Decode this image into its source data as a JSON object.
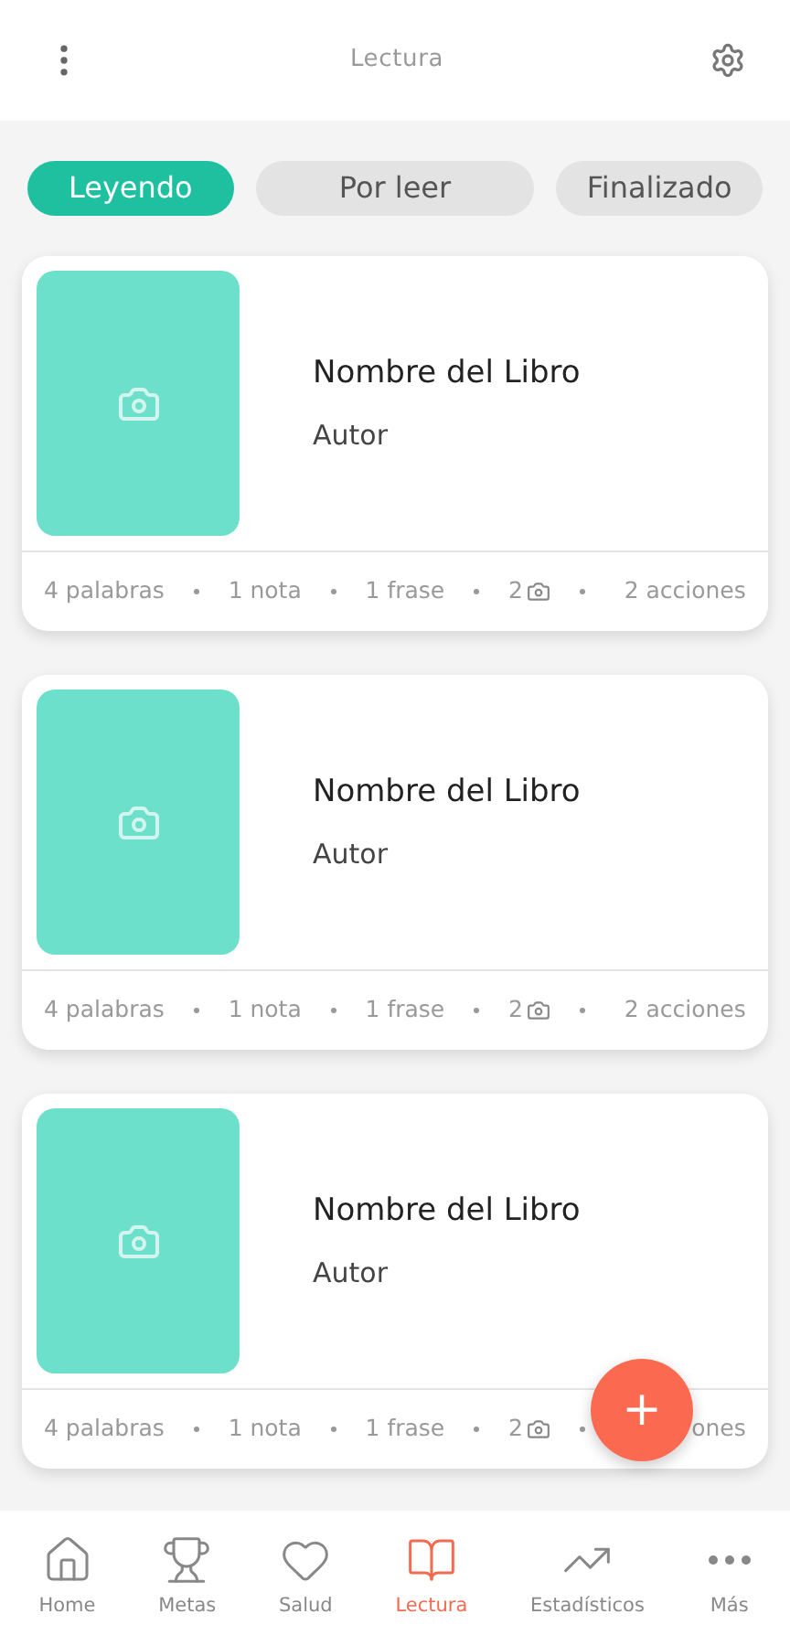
{
  "header": {
    "title": "Lectura"
  },
  "tabs": [
    {
      "label": "Leyendo",
      "selected": true
    },
    {
      "label": "Por leer",
      "selected": false
    },
    {
      "label": "Finalizado",
      "selected": false
    }
  ],
  "books": [
    {
      "title": "Nombre del Libro",
      "author": "Autor",
      "stats": [
        {
          "kind": "text",
          "text": "4 palabras"
        },
        {
          "kind": "text",
          "text": "1 nota"
        },
        {
          "kind": "text",
          "text": "1 frase"
        },
        {
          "kind": "photos",
          "text": "2"
        },
        {
          "kind": "text",
          "text": "2 acciones"
        }
      ]
    },
    {
      "title": "Nombre del Libro",
      "author": "Autor",
      "stats": [
        {
          "kind": "text",
          "text": "4 palabras"
        },
        {
          "kind": "text",
          "text": "1 nota"
        },
        {
          "kind": "text",
          "text": "1 frase"
        },
        {
          "kind": "photos",
          "text": "2"
        },
        {
          "kind": "text",
          "text": "2 acciones"
        }
      ]
    },
    {
      "title": "Nombre del Libro",
      "author": "Autor",
      "stats": [
        {
          "kind": "text",
          "text": "4 palabras"
        },
        {
          "kind": "text",
          "text": "1 nota"
        },
        {
          "kind": "text",
          "text": "1 frase"
        },
        {
          "kind": "photos",
          "text": "2"
        },
        {
          "kind": "text",
          "text": "ones"
        }
      ]
    }
  ],
  "fab": {
    "label": "+"
  },
  "nav": [
    {
      "label": "Home",
      "selected": false
    },
    {
      "label": "Metas",
      "selected": false
    },
    {
      "label": "Salud",
      "selected": false
    },
    {
      "label": "Lectura",
      "selected": true
    },
    {
      "label": "Estadísticos",
      "selected": false
    },
    {
      "label": "Más",
      "selected": false
    }
  ]
}
